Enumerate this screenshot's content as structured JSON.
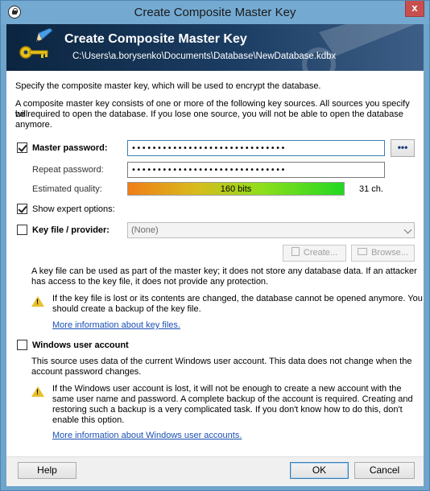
{
  "window": {
    "title": "Create Composite Master Key",
    "close_glyph": "x"
  },
  "banner": {
    "title": "Create Composite Master Key",
    "path": "C:\\Users\\a.borysenko\\Documents\\Database\\NewDatabase.kdbx",
    "icon": "key-pen-icon"
  },
  "intro": {
    "line1": "Specify the composite master key, which will be used to encrypt the database.",
    "line2a": "A composite master key consists of one or more of the following key sources. All sources you specify will",
    "line2b": "be required to open the database. If you lose one source, you will not be able to open the database",
    "line2c": "anymore."
  },
  "master_password": {
    "label": "Master password:",
    "value": "••••••••••••••••••••••••••••••",
    "checked": true,
    "toggle_label": "•••",
    "repeat_label": "Repeat password:",
    "repeat_value": "••••••••••••••••••••••••••••••",
    "quality_label": "Estimated quality:",
    "quality_text": "160 bits",
    "quality_fraction": 1.0,
    "chars": "31 ch."
  },
  "expert": {
    "label": "Show expert options:",
    "checked": true
  },
  "keyfile": {
    "label": "Key file / provider:",
    "checked": false,
    "selected": "(None)",
    "create_label": "Create...",
    "browse_label": "Browse...",
    "desc1": "A key file can be used as part of the master key; it does not store any database data. If an attacker",
    "desc2": "has access to the key file, it does not provide any protection.",
    "warn1": "If the key file is lost or its contents are changed, the database cannot be opened anymore. You",
    "warn2": "should create a backup of the key file.",
    "link": "More information about key files."
  },
  "windows_account": {
    "label": "Windows user account",
    "checked": false,
    "desc1": "This source uses data of the current Windows user account. This data does not change when the",
    "desc2": "account password changes.",
    "warn1": "If the Windows user account is lost, it will not be enough to create a new account with the",
    "warn2": "same user name and password. A complete backup of the account is required. Creating and",
    "warn3": "restoring such a backup is a very complicated task. If you don't know how to do this, don't",
    "warn4": "enable this option.",
    "link": "More information about Windows user accounts."
  },
  "footer": {
    "help": "Help",
    "ok": "OK",
    "cancel": "Cancel"
  },
  "colors": {
    "titlebar": "#74aad2",
    "banner_dark": "#0b2540",
    "link": "#1a4fb4",
    "warning": "#e8c12c"
  }
}
